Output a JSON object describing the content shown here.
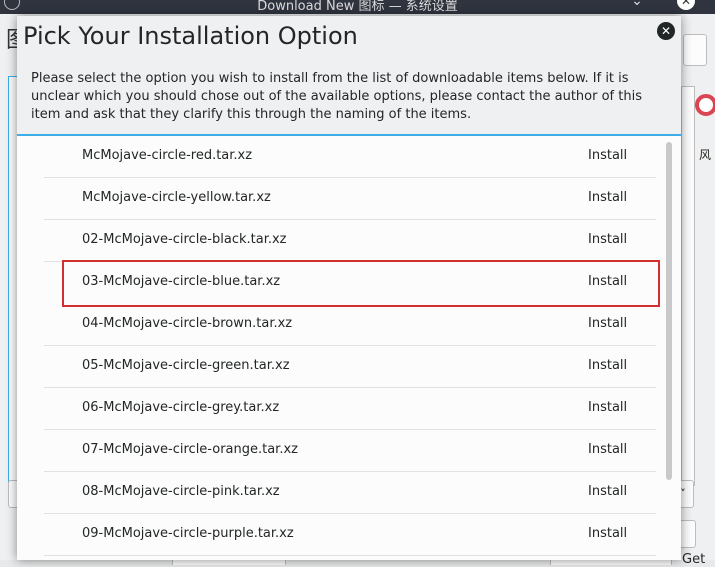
{
  "window": {
    "title": "Download New 图标 — 系统设置"
  },
  "parent": {
    "side_glyph": "图",
    "side_char": "风",
    "get_button": "Get"
  },
  "dialog": {
    "heading": "Pick Your Installation Option",
    "message": "Please select the option you wish to install from the list of downloadable items below. If it is unclear which you should chose out of the available options, please contact the author of this item and ask that they clarify this through the naming of the items.",
    "items": [
      {
        "name": "McMojave-circle-red.tar.xz",
        "action": "Install"
      },
      {
        "name": "McMojave-circle-yellow.tar.xz",
        "action": "Install"
      },
      {
        "name": "02-McMojave-circle-black.tar.xz",
        "action": "Install"
      },
      {
        "name": "03-McMojave-circle-blue.tar.xz",
        "action": "Install"
      },
      {
        "name": "04-McMojave-circle-brown.tar.xz",
        "action": "Install"
      },
      {
        "name": "05-McMojave-circle-green.tar.xz",
        "action": "Install"
      },
      {
        "name": "06-McMojave-circle-grey.tar.xz",
        "action": "Install"
      },
      {
        "name": "07-McMojave-circle-orange.tar.xz",
        "action": "Install"
      },
      {
        "name": "08-McMojave-circle-pink.tar.xz",
        "action": "Install"
      },
      {
        "name": "09-McMojave-circle-purple.tar.xz",
        "action": "Install"
      }
    ],
    "highlighted_item": "03-McMojave-circle-blue.tar.xz"
  },
  "colors": {
    "accent": "#3daee9",
    "highlight": "#d03030",
    "titlebar": "#2f343f"
  }
}
